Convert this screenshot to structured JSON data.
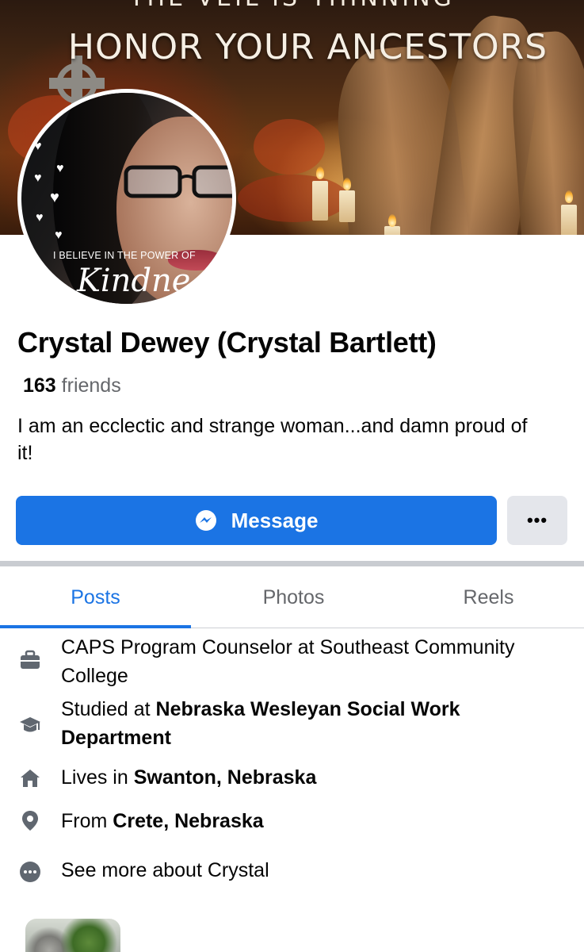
{
  "cover": {
    "top_text": "THE VEIL IS THINNING",
    "title": "HONOR YOUR ANCESTORS"
  },
  "avatar": {
    "caption": "I BELIEVE IN THE POWER OF",
    "script_text": "Kindne"
  },
  "profile": {
    "name": "Crystal Dewey (Crystal Bartlett)",
    "friends_count": "163",
    "friends_label": "friends",
    "bio": "I am an ecclectic and strange woman...and damn proud of it!"
  },
  "actions": {
    "message_label": "Message",
    "more_label": "•••"
  },
  "tabs": [
    {
      "label": "Posts",
      "active": true
    },
    {
      "label": "Photos",
      "active": false
    },
    {
      "label": "Reels",
      "active": false
    }
  ],
  "about": {
    "work": {
      "icon": "briefcase-icon",
      "text": "CAPS Program Counselor at Southeast Community College"
    },
    "education": {
      "icon": "graduation-cap-icon",
      "prefix": "Studied at ",
      "bold": "Nebraska Wesleyan Social Work Department"
    },
    "lives": {
      "icon": "home-icon",
      "prefix": "Lives in ",
      "bold": "Swanton, Nebraska"
    },
    "from": {
      "icon": "location-pin-icon",
      "prefix": "From ",
      "bold": "Crete, Nebraska"
    },
    "see_more": {
      "icon": "more-dots-icon",
      "text": "See more about Crystal"
    }
  },
  "colors": {
    "accent": "#1b74e4",
    "secondary_text": "#65676b",
    "button_gray": "#e4e6eb"
  }
}
